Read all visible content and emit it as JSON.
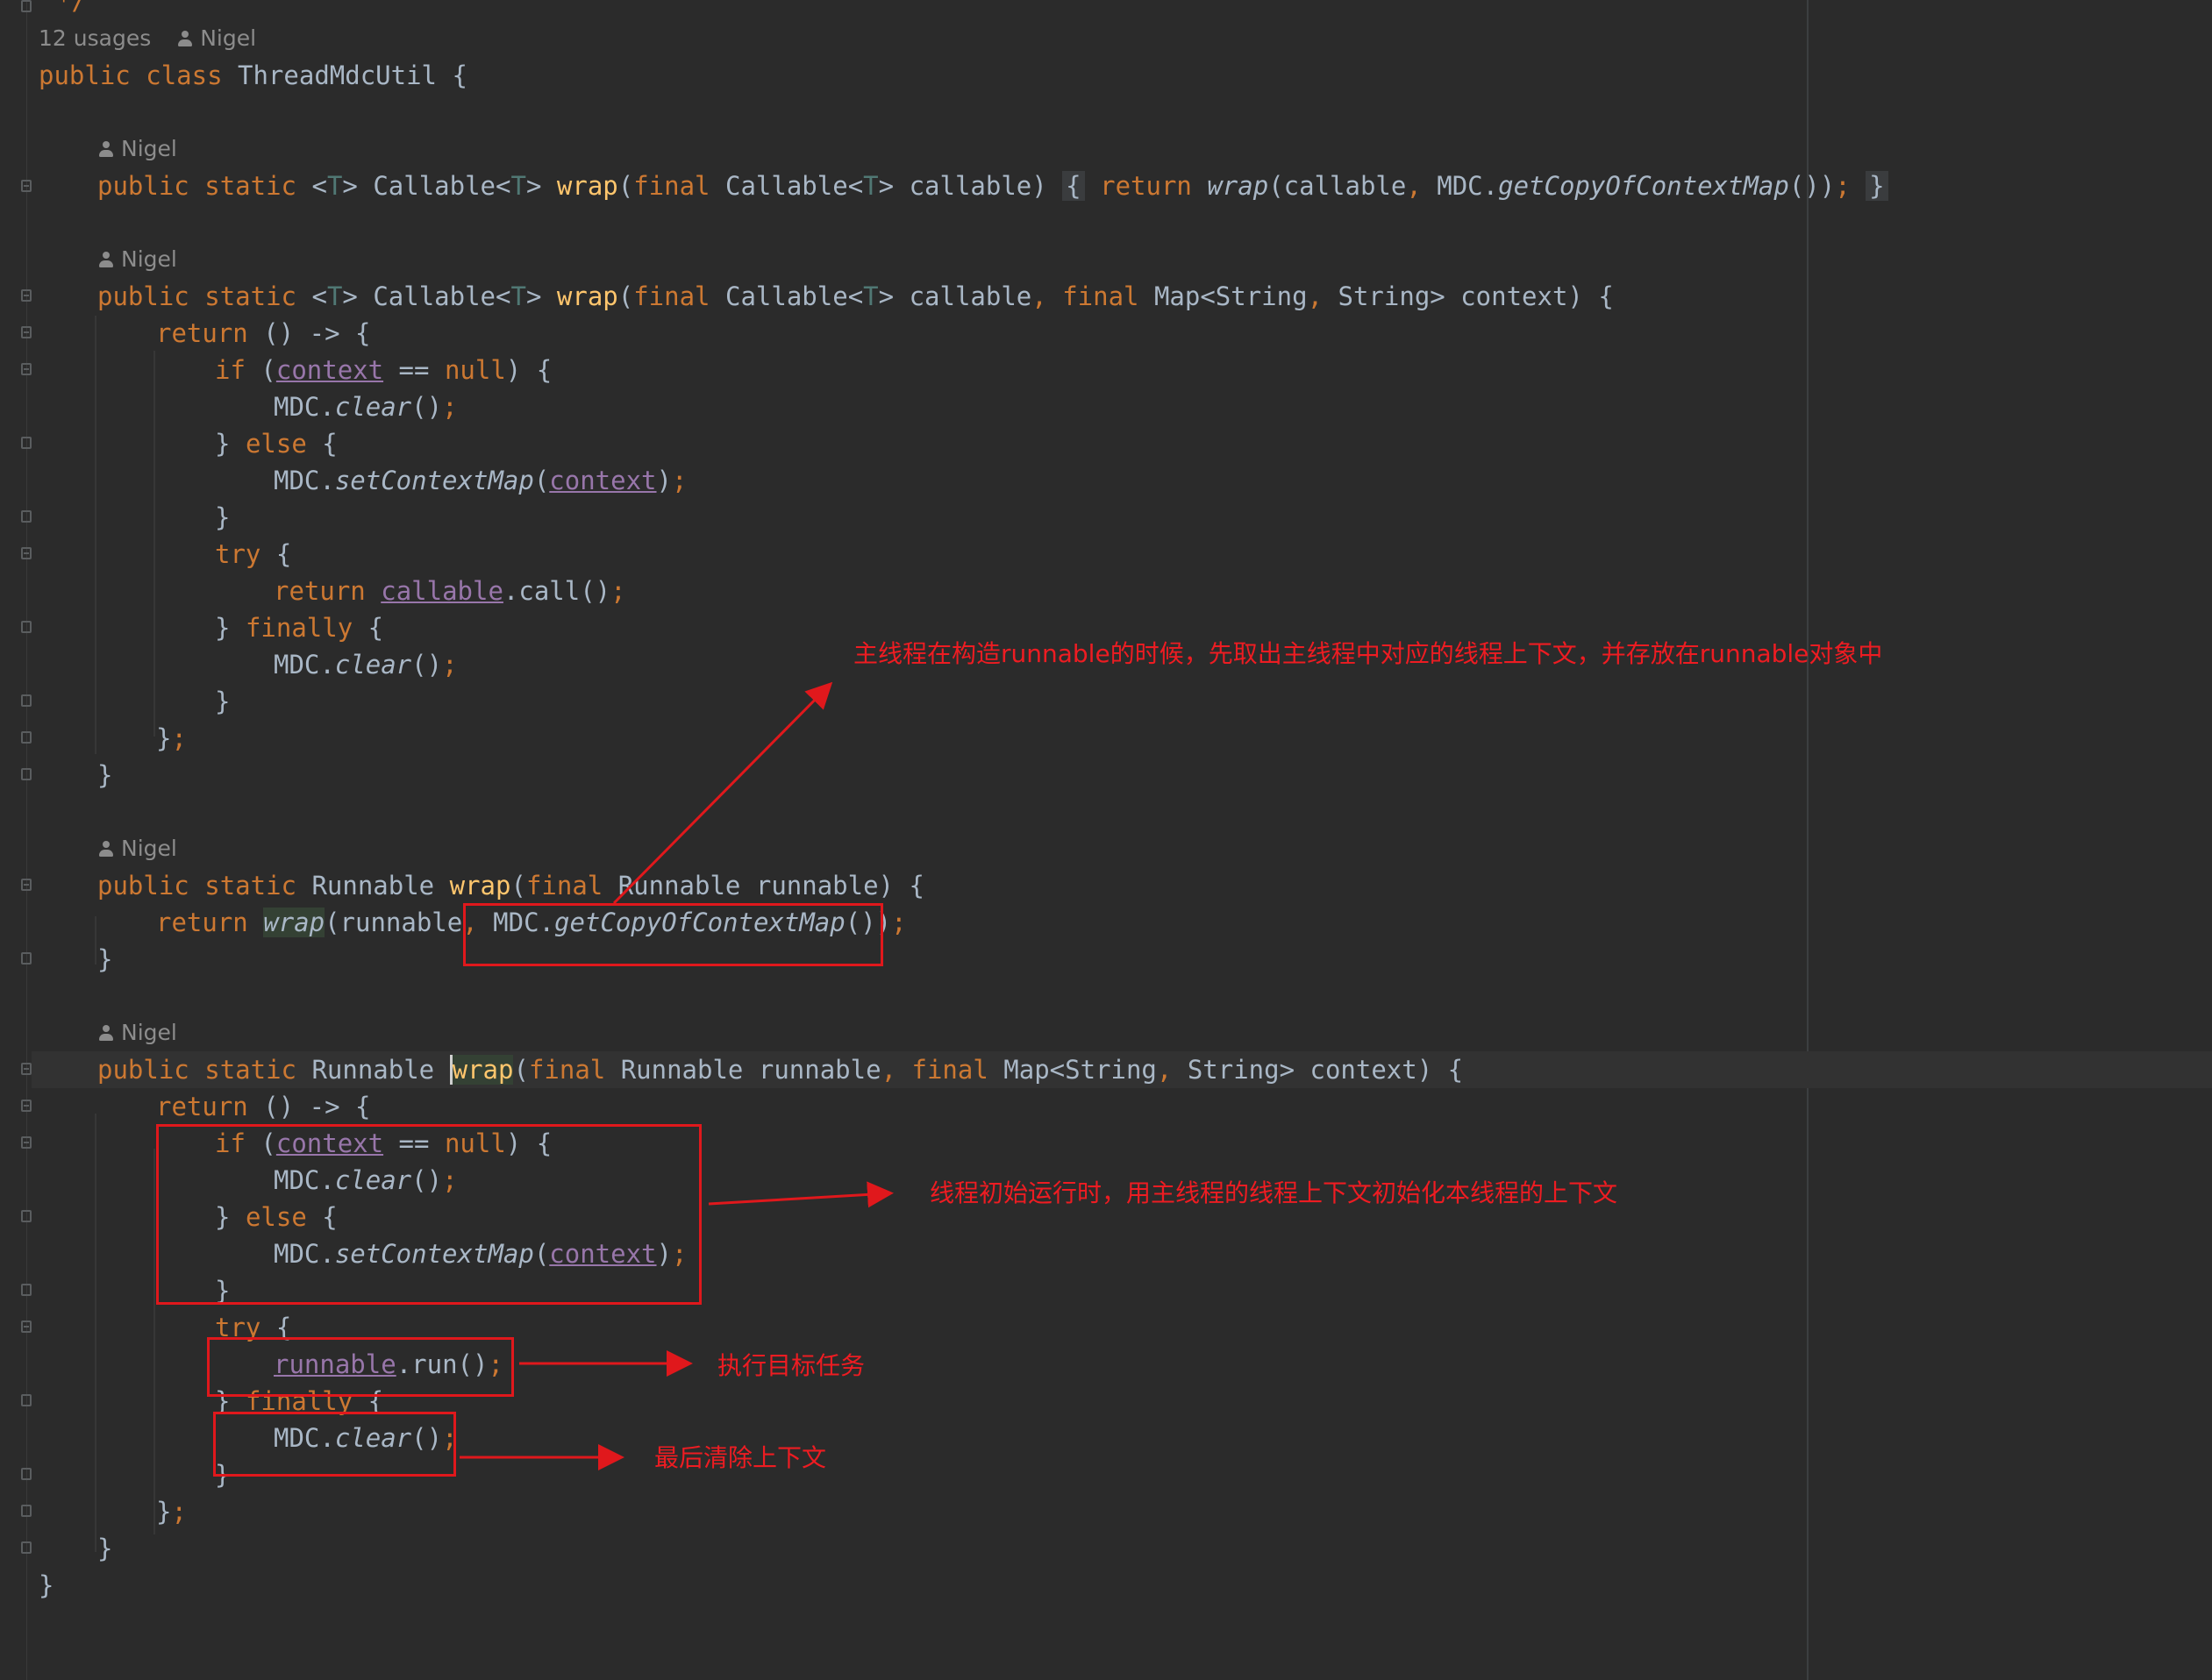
{
  "editor": {
    "header_usages": "12 usages",
    "author": "Nigel",
    "code": {
      "top_comment": "*/",
      "class_decl": {
        "kw1": "public",
        "kw2": "class",
        "name": "ThreadMdcUtil",
        "brace": "{"
      },
      "m1": {
        "kw1": "public",
        "kw2": "static",
        "lt": "<",
        "t": "T",
        "gt": ">",
        "ret": "Callable",
        "lt2": "<",
        "t2": "T",
        "gt2": ">",
        "name": "wrap",
        "p_open": "(",
        "final": "final",
        "ptype": "Callable",
        "lt3": "<",
        "t3": "T",
        "gt3": ">",
        "pname": "callable)",
        "fold_open": "{",
        "ret_kw": "return",
        "call": "wrap",
        "args": "(callable",
        "comma": ",",
        "mdc": "MDC.",
        "getcopy": "getCopyOfContextMap",
        "tail": "())",
        "semi": ";",
        "fold_close": "}"
      },
      "m2": {
        "sig_kw1": "public",
        "sig_kw2": "static",
        "lt": "<",
        "t": "T",
        "gt": ">",
        "ret": "Callable",
        "lt2": "<",
        "t2": "T",
        "gt2": ">",
        "name": "wrap",
        "p_open": "(",
        "final1": "final",
        "ptype": "Callable",
        "lt3": "<",
        "t3": "T",
        "gt3": ">",
        "p1": "callable",
        "comma1": ",",
        "final2": "final",
        "map": "Map<String",
        "comma2": ",",
        "map2": "String> context)",
        "brace": "{",
        "ret_lambda_kw": "return",
        "ret_lambda": "() -> {",
        "if_kw": "if",
        "if_open": "(",
        "ctx": "context",
        "eq": "==",
        "null_kw": "null",
        "if_close": ")",
        "if_brace": "{",
        "mdc_obj": "MDC.",
        "clear": "clear",
        "parens": "()",
        "semi": ";",
        "else_close": "}",
        "else_kw": "else",
        "else_brace": "{",
        "mdc_obj2": "MDC.",
        "setctx": "setContextMap",
        "p_open2": "(",
        "ctx2": "context",
        "p_close2": ")",
        "semi2": ";",
        "close1": "}",
        "try_kw": "try",
        "try_brace": "{",
        "ret2_kw": "return",
        "callable_ref": "callable",
        "call_m": ".call()",
        "semi3": ";",
        "fin_close": "}",
        "fin_kw": "finally",
        "fin_brace": "{",
        "mdc_obj3": "MDC.",
        "clear3": "clear",
        "parens3": "()",
        "semi4": ";",
        "close2": "}",
        "lambda_close": "}",
        "semi5": ";",
        "method_close": "}"
      },
      "m3": {
        "kw1": "public",
        "kw2": "static",
        "ret": "Runnable",
        "name": "wrap",
        "p_open": "(",
        "final": "final",
        "ptype": "Runnable",
        "pname": "runnable)",
        "brace": "{",
        "ret_kw": "return",
        "call": "wrap",
        "args": "(runnable",
        "comma": ",",
        "mdc": "MDC.",
        "getcopy": "getCopyOfContextMap",
        "tail": "())",
        "semi": ";",
        "close": "}"
      },
      "m4": {
        "kw1": "public",
        "kw2": "static",
        "ret": "Runnable",
        "name": "wrap",
        "p_open": "(",
        "final1": "final",
        "ptype": "Runnable",
        "p1": "runnable",
        "comma1": ",",
        "final2": "final",
        "map": "Map<String",
        "comma2": ",",
        "map2": "String> context)",
        "brace": "{",
        "ret_lambda_kw": "return",
        "ret_lambda": "() -> {",
        "if_kw": "if",
        "if_open": "(",
        "ctx": "context",
        "eq": "==",
        "null_kw": "null",
        "if_close": ")",
        "if_brace": "{",
        "mdc_obj": "MDC.",
        "clear": "clear",
        "parens": "()",
        "semi": ";",
        "else_close": "}",
        "else_kw": "else",
        "else_brace": "{",
        "mdc_obj2": "MDC.",
        "setctx": "setContextMap",
        "p_open2": "(",
        "ctx2": "context",
        "p_close2": ")",
        "semi2": ";",
        "close1": "}",
        "try_kw": "try",
        "try_brace": "{",
        "runnable_ref": "runnable",
        "run_m": ".run()",
        "semi3": ";",
        "fin_close": "}",
        "fin_kw": "finally",
        "fin_brace": "{",
        "mdc_obj3": "MDC.",
        "clear3": "clear",
        "parens3": "()",
        "semi4": ";",
        "close2": "}",
        "lambda_close": "}",
        "semi5": ";",
        "method_close": "}"
      },
      "class_close": "}"
    }
  },
  "annotations": {
    "main_thread_note": "主线程在构造runnable的时候，先取出主线程中对应的线程上下文，并存放在runnable对象中",
    "init_context_note": "线程初始运行时，用主线程的线程上下文初始化本线程的上下文",
    "run_task_note": "执行目标任务",
    "clear_note": "最后清除上下文",
    "color": "#ee1c22"
  },
  "theme": {
    "background": "#2b2b2b",
    "text": "#a9b7c6",
    "keyword": "#cc7832",
    "method": "#ffc66d",
    "type_param": "#507874",
    "param_ref": "#9876aa",
    "hint": "#8c8c8c"
  }
}
